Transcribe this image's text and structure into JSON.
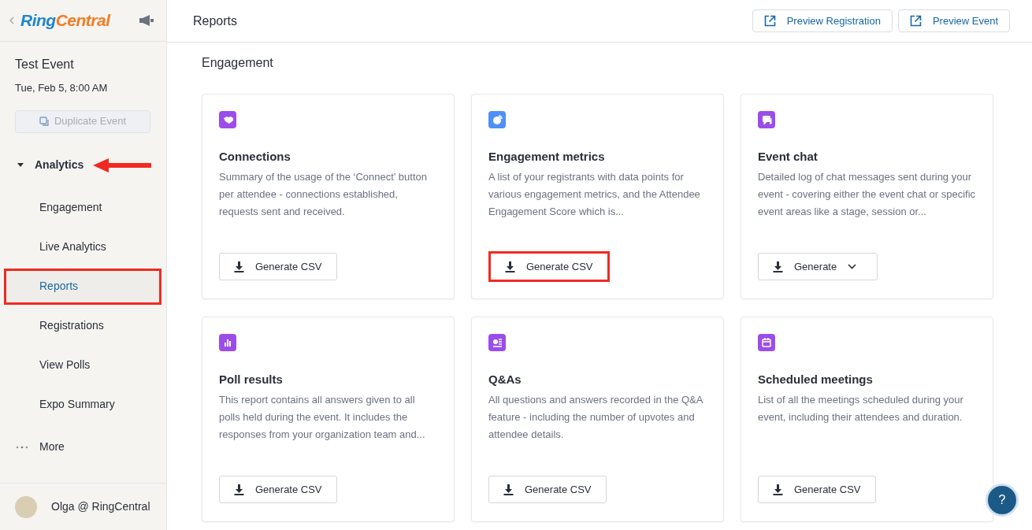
{
  "sidebar": {
    "brand": {
      "part1": "Ring",
      "part2": "Central"
    },
    "event": {
      "title": "Test Event",
      "date": "Tue, Feb 5, 8:00 AM",
      "duplicate_button": {
        "label": "Duplicate Event",
        "disabled": true
      }
    },
    "section": {
      "label": "Analytics",
      "expanded": true,
      "annotated": true
    },
    "items": [
      {
        "label": "Engagement",
        "selected": false,
        "highlighted": false
      },
      {
        "label": "Live Analytics",
        "selected": false,
        "highlighted": false
      },
      {
        "label": "Reports",
        "selected": true,
        "highlighted": true
      },
      {
        "label": "Registrations",
        "selected": false,
        "highlighted": false
      },
      {
        "label": "View Polls",
        "selected": false,
        "highlighted": false
      },
      {
        "label": "Expo Summary",
        "selected": false,
        "highlighted": false
      }
    ],
    "more": "More",
    "user": "Olga @ RingCentral"
  },
  "header": {
    "title": "Reports",
    "buttons": [
      "Preview Registration",
      "Preview Event"
    ]
  },
  "section_title": "Engagement",
  "cards": [
    {
      "color": "#9b4dea",
      "title": "Connections",
      "description": "Summary of the usage of the ‘Connect’ button per attendee - connections established, requests sent and received.",
      "button": "Generate CSV",
      "dropdown": false,
      "highlighted": false
    },
    {
      "color": "#4f8ff7",
      "title": "Engagement metrics",
      "description": "A list of your registrants with data points for various engagement metrics, and the Attendee Engagement Score which is...",
      "button": "Generate CSV",
      "dropdown": false,
      "highlighted": true
    },
    {
      "color": "#9b4dea",
      "title": "Event chat",
      "description": "Detailed log of chat messages sent during your event - covering either the event chat or specific event areas like a stage, session or...",
      "button": "Generate",
      "dropdown": true,
      "highlighted": false
    },
    {
      "color": "#9b4dea",
      "title": "Poll results",
      "description": "This report contains all answers given to all polls held during the event. It includes the responses from your organization team and...",
      "button": "Generate CSV",
      "dropdown": false,
      "highlighted": false
    },
    {
      "color": "#9b4dea",
      "title": "Q&As",
      "description": "All questions and answers recorded in the Q&A feature - including the number of upvotes and attendee details.",
      "button": "Generate CSV",
      "dropdown": false,
      "highlighted": false
    },
    {
      "color": "#9b4dea",
      "title": "Scheduled meetings",
      "description": "List of all the meetings scheduled during your event, including their attendees and duration.",
      "button": "Generate CSV",
      "dropdown": false,
      "highlighted": false
    }
  ],
  "help_button": "?"
}
